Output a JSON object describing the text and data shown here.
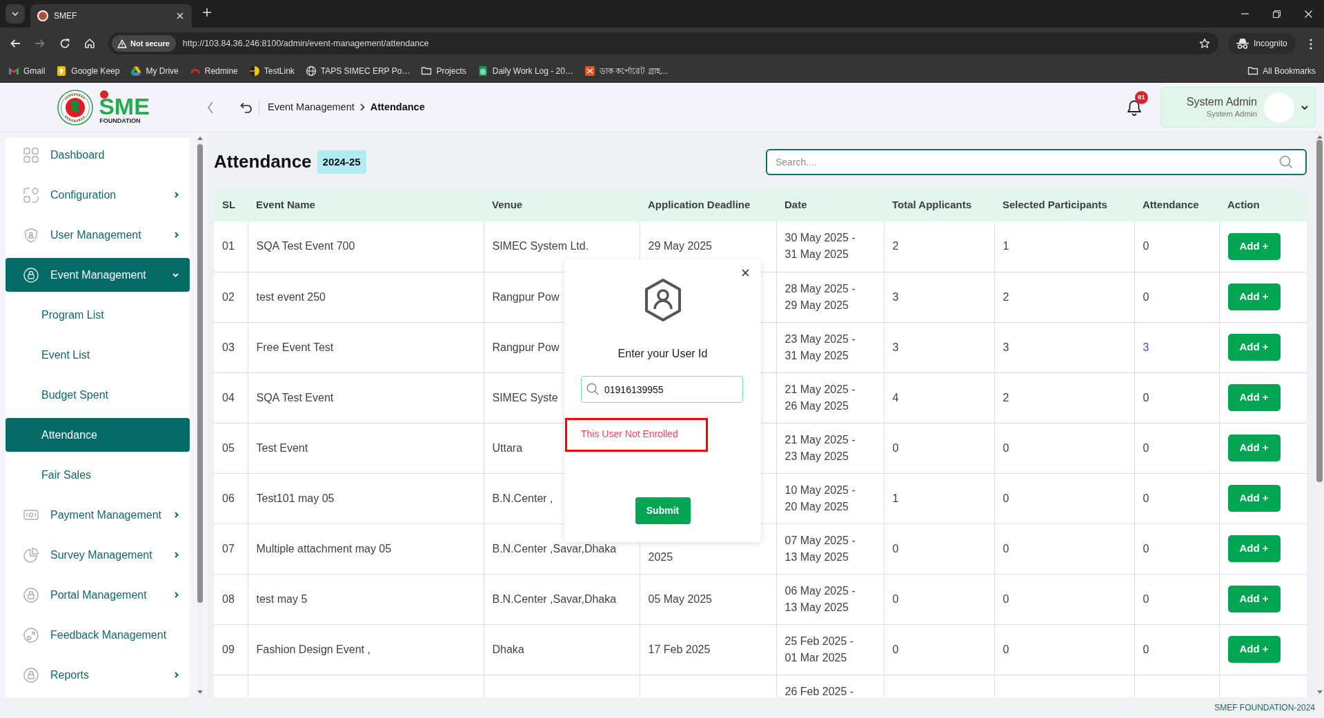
{
  "browser": {
    "tab_title": "SMEF",
    "not_secure": "Not secure",
    "url": "http://103.84.36.246:8100/admin/event-management/attendance",
    "profile": "Incognito",
    "bookmarks": [
      "Gmail",
      "Google Keep",
      "My Drive",
      "Redmine",
      "TestLink",
      "TAPS SIMEC ERP Po…",
      "Projects",
      "Daily Work Log - 20…",
      "ডাক কর্পোরেট গ্রাহ…"
    ],
    "all_bookmarks": "All Bookmarks"
  },
  "header": {
    "logo": {
      "text": "SME",
      "subtext": "FOUNDATION"
    },
    "breadcrumb": [
      {
        "label": "Event Management",
        "selected": false
      },
      {
        "label": "Attendance",
        "selected": true
      }
    ],
    "notification_count": "61",
    "user": {
      "name": "System Admin",
      "role": "System Admin"
    }
  },
  "sidebar": {
    "items": [
      {
        "label": "Dashboard",
        "kind": "link",
        "selected": false
      },
      {
        "label": "Configuration",
        "kind": "menu",
        "expanded": false,
        "selected": false
      },
      {
        "label": "User Management",
        "kind": "menu",
        "expanded": false,
        "selected": false
      },
      {
        "label": "Event Management",
        "kind": "menu",
        "expanded": true,
        "selected": true,
        "children": [
          {
            "label": "Program List",
            "selected": false
          },
          {
            "label": "Event List",
            "selected": false
          },
          {
            "label": "Budget Spent",
            "selected": false
          },
          {
            "label": "Attendance",
            "selected": true
          },
          {
            "label": "Fair Sales",
            "selected": false
          }
        ]
      },
      {
        "label": "Payment Management",
        "kind": "menu",
        "expanded": false,
        "selected": false
      },
      {
        "label": "Survey Management",
        "kind": "menu",
        "expanded": false,
        "selected": false
      },
      {
        "label": "Portal Management",
        "kind": "menu",
        "expanded": false,
        "selected": false
      },
      {
        "label": "Feedback Management",
        "kind": "link",
        "selected": false
      },
      {
        "label": "Reports",
        "kind": "menu",
        "expanded": false,
        "selected": false
      }
    ]
  },
  "page": {
    "title": "Attendance",
    "badge": "2024-25",
    "search": {
      "placeholder": "Search...."
    }
  },
  "table": {
    "columns": [
      "SL",
      "Event Name",
      "Venue",
      "Application Deadline",
      "Date",
      "Total Applicants",
      "Selected Participants",
      "Attendance",
      "Action"
    ],
    "rows": [
      {
        "sl": "01",
        "event_name": "SQA Test Event 700",
        "venue": "SIMEC System Ltd.",
        "deadline": "29 May 2025",
        "date": "30 May 2025 - 31 May 2025",
        "total_applicants": "2",
        "selected_participants": "1",
        "attendance": "0",
        "attendance_is_link": false,
        "action": "Add +"
      },
      {
        "sl": "02",
        "event_name": "test event 250",
        "venue": "Rangpur Pow",
        "date": "28 May 2025 - 29 May 2025",
        "total_applicants": "3",
        "selected_participants": "2",
        "attendance": "0",
        "attendance_is_link": false,
        "action": "Add +"
      },
      {
        "sl": "03",
        "event_name": "Free Event Test",
        "venue": "Rangpur Pow",
        "date": "23 May 2025 - 31 May 2025",
        "total_applicants": "3",
        "selected_participants": "3",
        "attendance": "3",
        "attendance_is_link": true,
        "action": "Add +"
      },
      {
        "sl": "04",
        "event_name": "SQA Test Event",
        "venue": "SIMEC Syste",
        "date": "21 May 2025 - 26 May 2025",
        "total_applicants": "4",
        "selected_participants": "2",
        "attendance": "0",
        "attendance_is_link": false,
        "action": "Add +"
      },
      {
        "sl": "05",
        "event_name": "Test Event",
        "venue": "Uttara",
        "date": "21 May 2025 - 23 May 2025",
        "total_applicants": "0",
        "selected_participants": "0",
        "attendance": "0",
        "attendance_is_link": false,
        "action": "Add +"
      },
      {
        "sl": "06",
        "event_name": "Test101 may 05",
        "venue": "B.N.Center ,",
        "date": "10 May 2025 - 20 May 2025",
        "total_applicants": "1",
        "selected_participants": "0",
        "attendance": "0",
        "attendance_is_link": false,
        "action": "Add +"
      },
      {
        "sl": "07",
        "event_name": "Multiple attachment may 05",
        "venue": "B.N.Center ,Savar,Dhaka",
        "deadline": "2025",
        "deadline_covered": true,
        "date": "07 May 2025 - 13 May 2025",
        "total_applicants": "0",
        "selected_participants": "0",
        "attendance": "0",
        "attendance_is_link": false,
        "action": "Add +"
      },
      {
        "sl": "08",
        "event_name": "test may 5",
        "venue": "B.N.Center ,Savar,Dhaka",
        "deadline": "05 May 2025",
        "date": "06 May 2025 - 13 May 2025",
        "total_applicants": "0",
        "selected_participants": "0",
        "attendance": "0",
        "attendance_is_link": false,
        "action": "Add +"
      },
      {
        "sl": "09",
        "event_name": "Fashion Design Event ,",
        "venue": "Dhaka",
        "deadline": "17 Feb 2025",
        "date": "25 Feb 2025 - 01 Mar 2025",
        "total_applicants": "0",
        "selected_participants": "0",
        "attendance": "0",
        "attendance_is_link": false,
        "action": "Add +"
      },
      {
        "date": "26 Feb 2025 -"
      }
    ]
  },
  "modal": {
    "prompt": "Enter your User Id",
    "user_id": "01916139955",
    "error": "This User Not Enrolled",
    "submit": "Submit"
  },
  "footer": "SMEF FOUNDATION-2024"
}
